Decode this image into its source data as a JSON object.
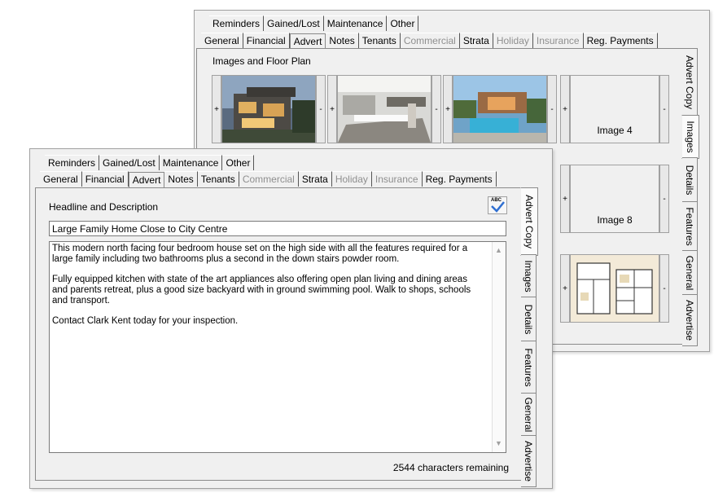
{
  "back_window": {
    "tab_row1": [
      "Reminders",
      "Gained/Lost",
      "Maintenance",
      "Other"
    ],
    "tab_row2": [
      {
        "label": "General",
        "disabled": false
      },
      {
        "label": "Financial",
        "disabled": false
      },
      {
        "label": "Advert",
        "disabled": false,
        "active": true
      },
      {
        "label": "Notes",
        "disabled": false
      },
      {
        "label": "Tenants",
        "disabled": false
      },
      {
        "label": "Commercial",
        "disabled": true
      },
      {
        "label": "Strata",
        "disabled": false
      },
      {
        "label": "Holiday",
        "disabled": true
      },
      {
        "label": "Insurance",
        "disabled": true
      },
      {
        "label": "Reg. Payments",
        "disabled": false
      }
    ],
    "section_title": "Images and Floor Plan",
    "side_tabs": [
      "Advert Copy",
      "Images",
      "Details",
      "Features",
      "General",
      "Advertise"
    ],
    "active_side_tab": "Images",
    "image_slots": [
      {
        "label": "",
        "has_image": true,
        "image": "house-exterior"
      },
      {
        "label": "",
        "has_image": true,
        "image": "kitchen"
      },
      {
        "label": "",
        "has_image": true,
        "image": "pool"
      },
      {
        "label": "Image 4",
        "has_image": false
      },
      {
        "label": "Image 8",
        "has_image": false
      },
      {
        "label": "",
        "has_image": true,
        "image": "floor-plan"
      }
    ],
    "add_symbol": "+",
    "remove_symbol": "-"
  },
  "front_window": {
    "tab_row1": [
      "Reminders",
      "Gained/Lost",
      "Maintenance",
      "Other"
    ],
    "tab_row2": [
      {
        "label": "General",
        "disabled": false
      },
      {
        "label": "Financial",
        "disabled": false
      },
      {
        "label": "Advert",
        "disabled": false,
        "active": true
      },
      {
        "label": "Notes",
        "disabled": false
      },
      {
        "label": "Tenants",
        "disabled": false
      },
      {
        "label": "Commercial",
        "disabled": true
      },
      {
        "label": "Strata",
        "disabled": false
      },
      {
        "label": "Holiday",
        "disabled": true
      },
      {
        "label": "Insurance",
        "disabled": true
      },
      {
        "label": "Reg. Payments",
        "disabled": false
      }
    ],
    "section_title": "Headline and Description",
    "spellcheck_label": "ABC",
    "headline": "Large Family Home Close to City Centre",
    "description": [
      "This modern north facing four bedroom house set on the high side with all the features required for a large family including two bathrooms plus a second in the down stairs powder room.",
      "Fully equipped kitchen with state of the art appliances also offering open plan living and dining areas and parents retreat, plus a good size backyard with in ground swimming pool. Walk to shops, schools and transport.",
      "Contact Clark Kent today for your inspection."
    ],
    "chars_remaining": "2544 characters remaining",
    "side_tabs": [
      "Advert Copy",
      "Images",
      "Details",
      "Features",
      "General",
      "Advertise"
    ],
    "active_side_tab": "Advert Copy"
  },
  "colors": {
    "panel_bg": "#f0f0f0",
    "disabled_text": "#8f8f8f",
    "border": "#8a8a8a"
  }
}
